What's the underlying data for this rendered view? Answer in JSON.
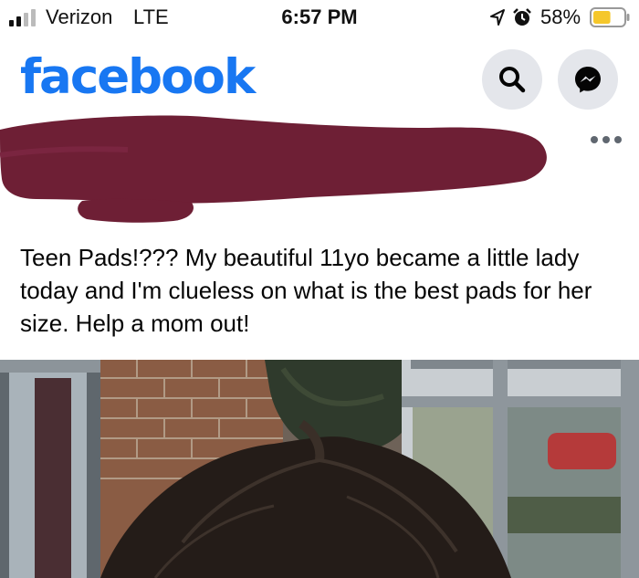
{
  "status_bar": {
    "carrier": "Verizon",
    "network": "LTE",
    "time": "6:57 PM",
    "battery_percent": "58%",
    "battery_level": 0.58,
    "icons": [
      "signal-icon",
      "location-icon",
      "alarm-icon",
      "battery-icon"
    ]
  },
  "header": {
    "logo": "facebook",
    "brand_color": "#1877f2",
    "buttons": [
      {
        "icon": "search-icon"
      },
      {
        "icon": "messenger-icon"
      }
    ]
  },
  "post": {
    "author_redacted": true,
    "redaction_color": "#6e1f35",
    "text": "Teen Pads!??? My beautiful 11yo became a little lady today and I'm clueless on what is the best pads for her size.  Help a mom out!",
    "menu_icon": "more-options-icon",
    "photo": "post-photo"
  }
}
